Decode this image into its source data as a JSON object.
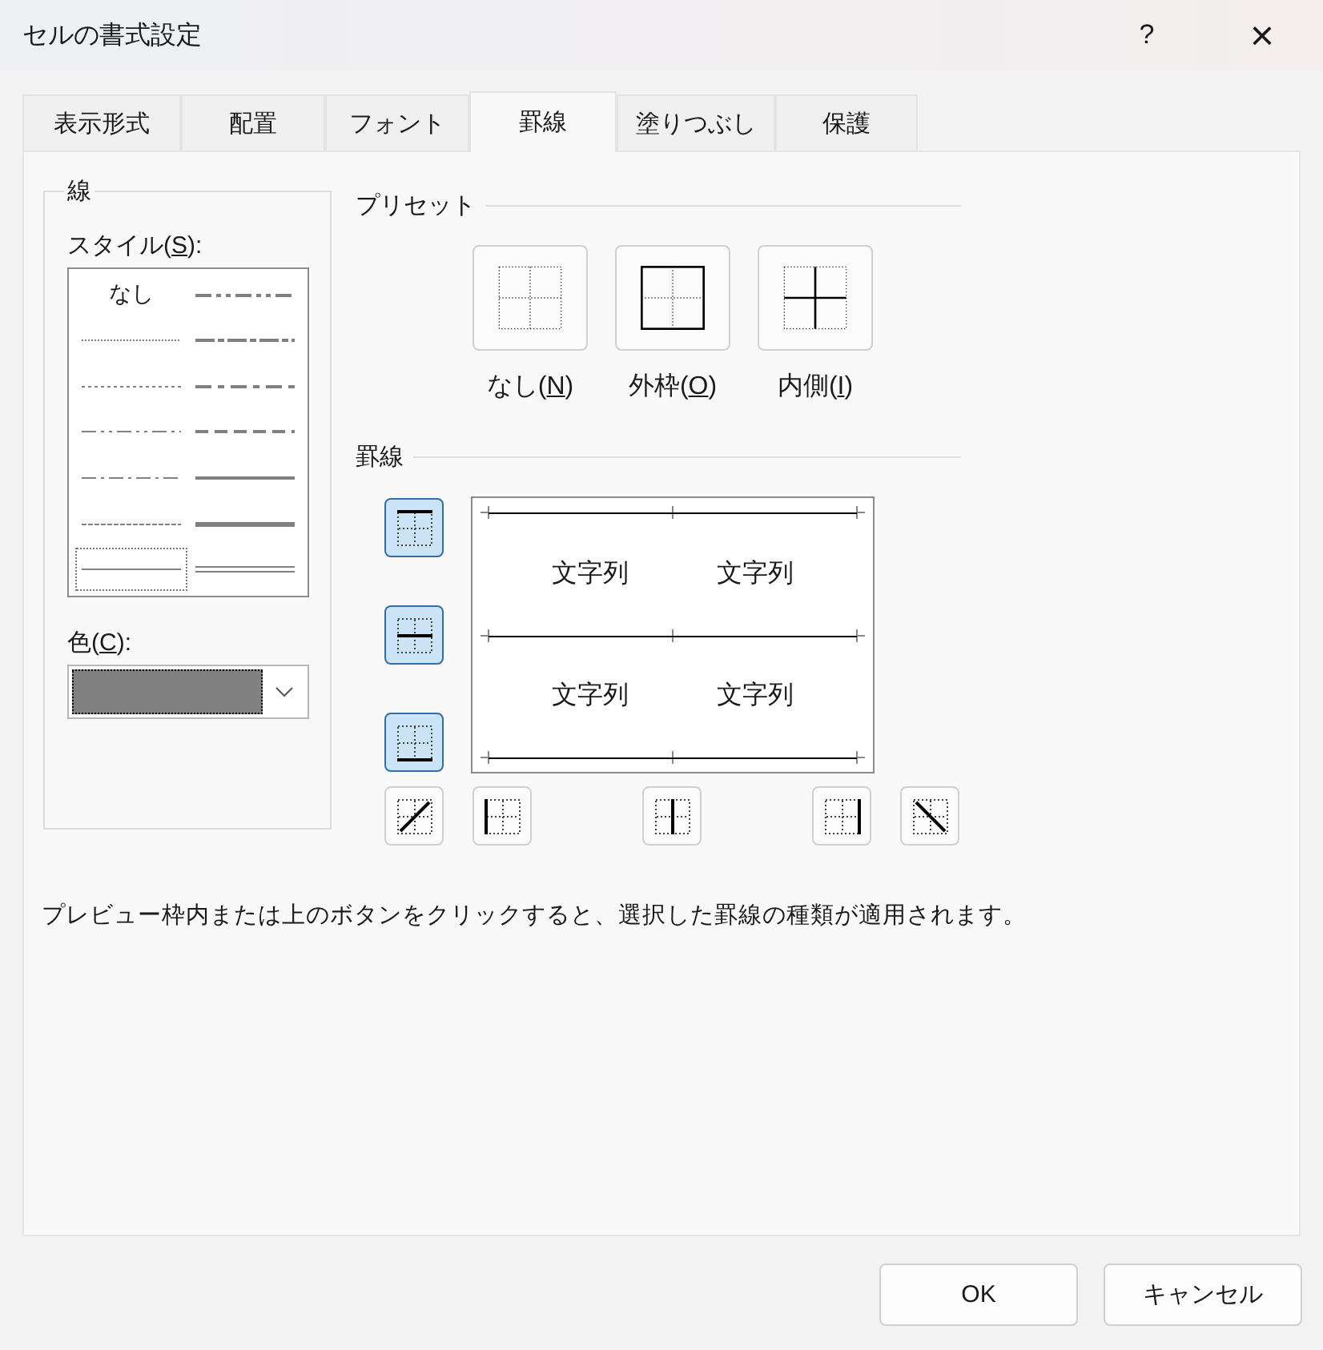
{
  "window": {
    "title": "セルの書式設定",
    "help": "?",
    "close": "×"
  },
  "tabs": [
    {
      "label": "表示形式",
      "selected": false
    },
    {
      "label": "配置",
      "selected": false
    },
    {
      "label": "フォント",
      "selected": false
    },
    {
      "label": "罫線",
      "selected": true
    },
    {
      "label": "塗りつぶし",
      "selected": false
    },
    {
      "label": "保護",
      "selected": false
    }
  ],
  "line_group": {
    "title": "線",
    "style_label": {
      "before": "スタイル(",
      "key": "S",
      "after": "):"
    },
    "styles": [
      {
        "kind": "none",
        "label": "なし",
        "selected": false
      },
      {
        "kind": "hair",
        "selected": false
      },
      {
        "kind": "dotted",
        "selected": false
      },
      {
        "kind": "dash-dot-dot",
        "selected": false
      },
      {
        "kind": "dash-dot",
        "selected": false
      },
      {
        "kind": "dashed",
        "selected": false
      },
      {
        "kind": "thin",
        "selected": true
      },
      {
        "kind": "medium-dash-dot-dot",
        "selected": false
      },
      {
        "kind": "slanted-dash-dot",
        "selected": false
      },
      {
        "kind": "medium-dash-dot",
        "selected": false
      },
      {
        "kind": "medium-dashed",
        "selected": false
      },
      {
        "kind": "medium",
        "selected": false
      },
      {
        "kind": "thick",
        "selected": false
      },
      {
        "kind": "double",
        "selected": false
      }
    ],
    "color_label": {
      "before": "色(",
      "key": "C",
      "after": "):"
    },
    "color": "#808080"
  },
  "presets": {
    "title": "プリセット",
    "items": [
      {
        "kind": "none",
        "before": "なし(",
        "key": "N",
        "after": ")"
      },
      {
        "kind": "outline",
        "before": "外枠(",
        "key": "O",
        "after": ")"
      },
      {
        "kind": "inside",
        "before": "内側(",
        "key": "I",
        "after": ")"
      }
    ]
  },
  "border": {
    "title": "罫線",
    "buttons": [
      {
        "kind": "top",
        "selected": true
      },
      {
        "kind": "middle",
        "selected": true
      },
      {
        "kind": "bottom",
        "selected": true
      },
      {
        "kind": "diag-up",
        "selected": false
      },
      {
        "kind": "left",
        "selected": false
      },
      {
        "kind": "center",
        "selected": false
      },
      {
        "kind": "right",
        "selected": false
      },
      {
        "kind": "diag-down",
        "selected": false
      }
    ],
    "preview_texts": [
      "文字列",
      "文字列",
      "文字列",
      "文字列"
    ]
  },
  "note": "プレビュー枠内または上のボタンをクリックすると、選択した罫線の種類が適用されます。",
  "buttons": [
    "OK",
    "キャンセル"
  ]
}
